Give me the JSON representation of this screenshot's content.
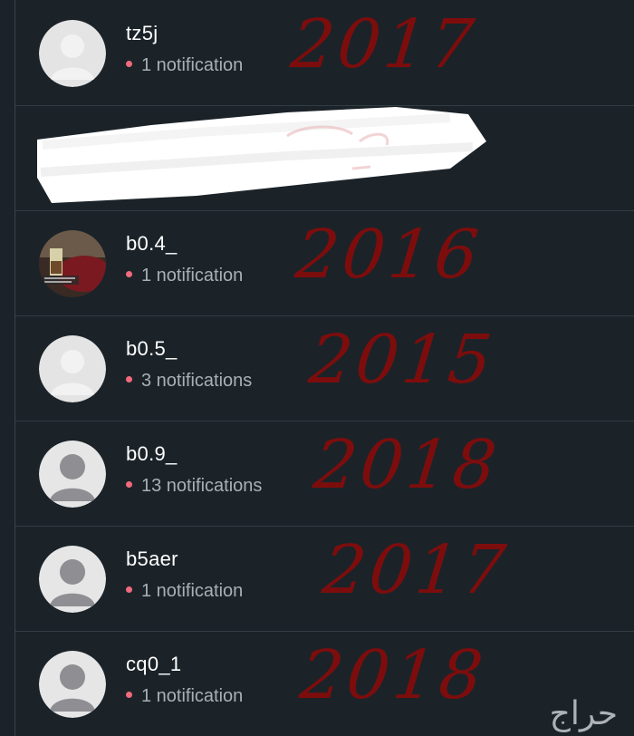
{
  "accounts": [
    {
      "username": "tz5j",
      "notifications": "1 notification",
      "year": "2017",
      "avatar": "blank-light"
    },
    {
      "username": "",
      "notifications": "",
      "year": "",
      "avatar": "redacted"
    },
    {
      "username": "b0.4_",
      "notifications": "1 notification",
      "year": "2016",
      "avatar": "photo"
    },
    {
      "username": "b0.5_",
      "notifications": "3 notifications",
      "year": "2015",
      "avatar": "blank-light"
    },
    {
      "username": "b0.9_",
      "notifications": "13 notifications",
      "year": "2018",
      "avatar": "default-person"
    },
    {
      "username": "b5aer",
      "notifications": "1 notification",
      "year": "2017",
      "avatar": "default-person"
    },
    {
      "username": "cq0_1",
      "notifications": "1 notification",
      "year": "2018",
      "avatar": "default-person"
    }
  ],
  "watermark": "حراج",
  "colors": {
    "background": "#1b2329",
    "divider": "#323c43",
    "notification_dot": "#f06b7b",
    "annotation_ink": "#7d0d0d"
  }
}
